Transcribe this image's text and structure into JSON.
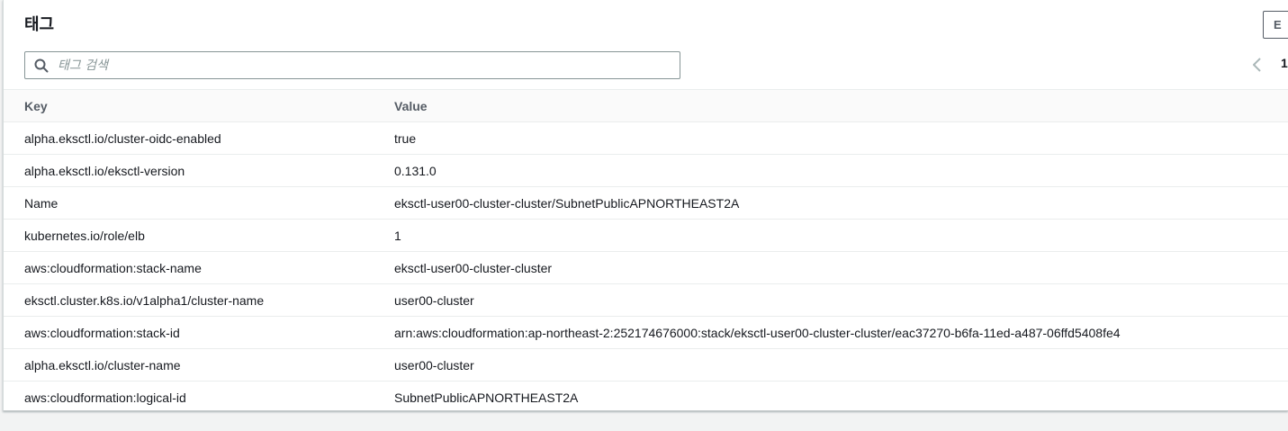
{
  "panel": {
    "title": "태그",
    "edit_label": "E"
  },
  "search": {
    "placeholder": "태그 검색",
    "value": ""
  },
  "pagination": {
    "current_page": "1"
  },
  "table": {
    "columns": [
      "Key",
      "Value"
    ],
    "rows": [
      {
        "key": "alpha.eksctl.io/cluster-oidc-enabled",
        "value": "true"
      },
      {
        "key": "alpha.eksctl.io/eksctl-version",
        "value": "0.131.0"
      },
      {
        "key": "Name",
        "value": "eksctl-user00-cluster-cluster/SubnetPublicAPNORTHEAST2A"
      },
      {
        "key": "kubernetes.io/role/elb",
        "value": "1"
      },
      {
        "key": "aws:cloudformation:stack-name",
        "value": "eksctl-user00-cluster-cluster"
      },
      {
        "key": "eksctl.cluster.k8s.io/v1alpha1/cluster-name",
        "value": "user00-cluster"
      },
      {
        "key": "aws:cloudformation:stack-id",
        "value": "arn:aws:cloudformation:ap-northeast-2:252174676000:stack/eksctl-user00-cluster-cluster/eac37270-b6fa-11ed-a487-06ffd5408fe4"
      },
      {
        "key": "alpha.eksctl.io/cluster-name",
        "value": "user00-cluster"
      },
      {
        "key": "aws:cloudformation:logical-id",
        "value": "SubnetPublicAPNORTHEAST2A"
      }
    ]
  },
  "icons": {
    "search": "search-icon",
    "previous": "chevron-left-icon"
  },
  "colors": {
    "page_background": "#f2f3f3",
    "header_text": "#545b64",
    "body_text": "#16191f",
    "border": "#eaeded"
  }
}
